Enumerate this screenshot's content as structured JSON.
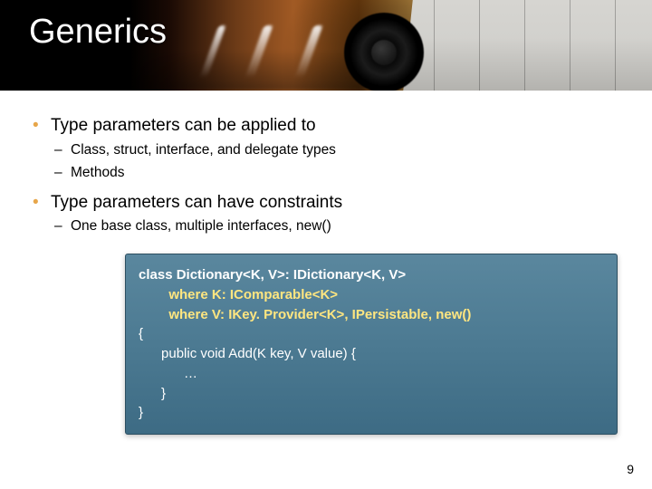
{
  "title": "Generics",
  "bullets": [
    {
      "text": "Type parameters can be applied to",
      "sub": [
        "Class, struct, interface, and delegate types",
        "Methods"
      ]
    },
    {
      "text": "Type parameters can have constraints",
      "sub": [
        "One base class, multiple interfaces, new()"
      ]
    }
  ],
  "code": {
    "l1a": "class Dictionary<K, V>: IDictionary<K, V>",
    "l2a": "where K: IComparable<K>",
    "l3a": "where V: IKey. Provider<K>, IPersistable, new()",
    "l4": "{",
    "l5": "public void Add(K key, V value) {",
    "l6": "…",
    "l7": "}",
    "l8": "}"
  },
  "page": "9"
}
